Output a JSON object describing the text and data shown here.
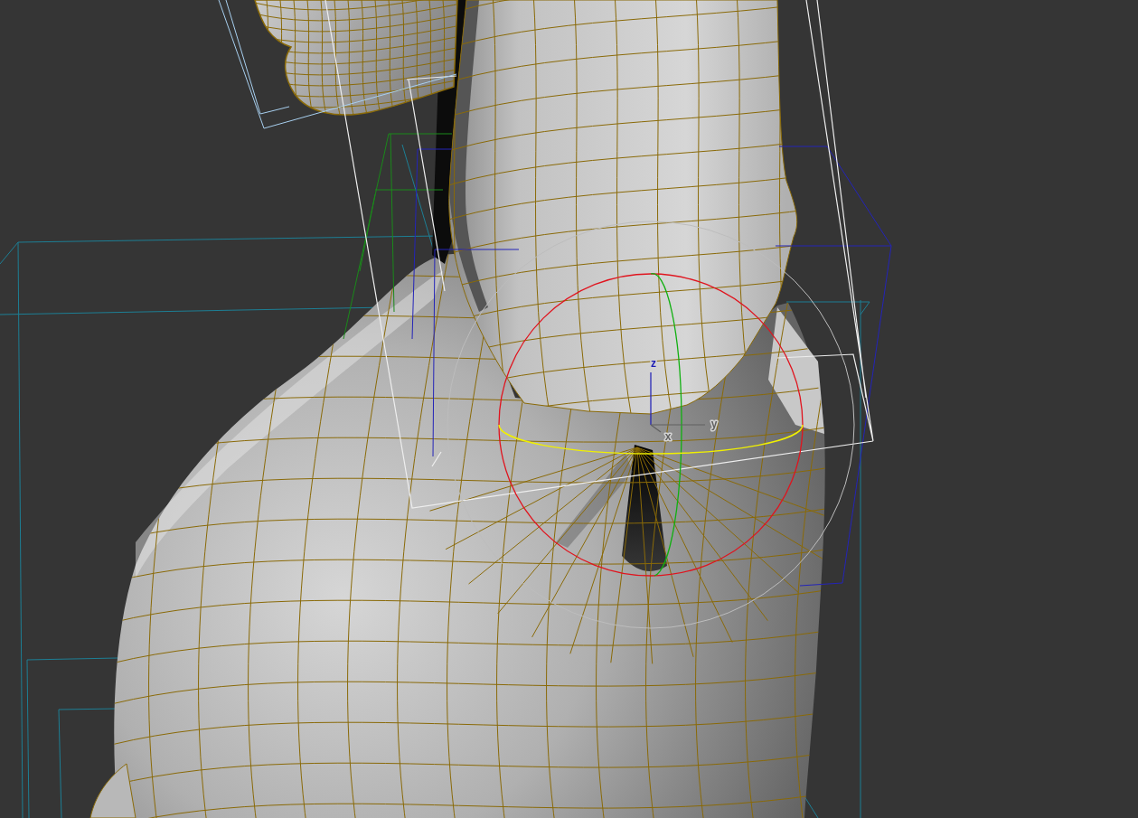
{
  "viewport": {
    "gizmo": {
      "axes": [
        {
          "label": "z",
          "color": "#1c1cb4"
        },
        {
          "label": "y",
          "color": "#606060"
        },
        {
          "label": "x",
          "color": "#606060"
        }
      ]
    }
  }
}
